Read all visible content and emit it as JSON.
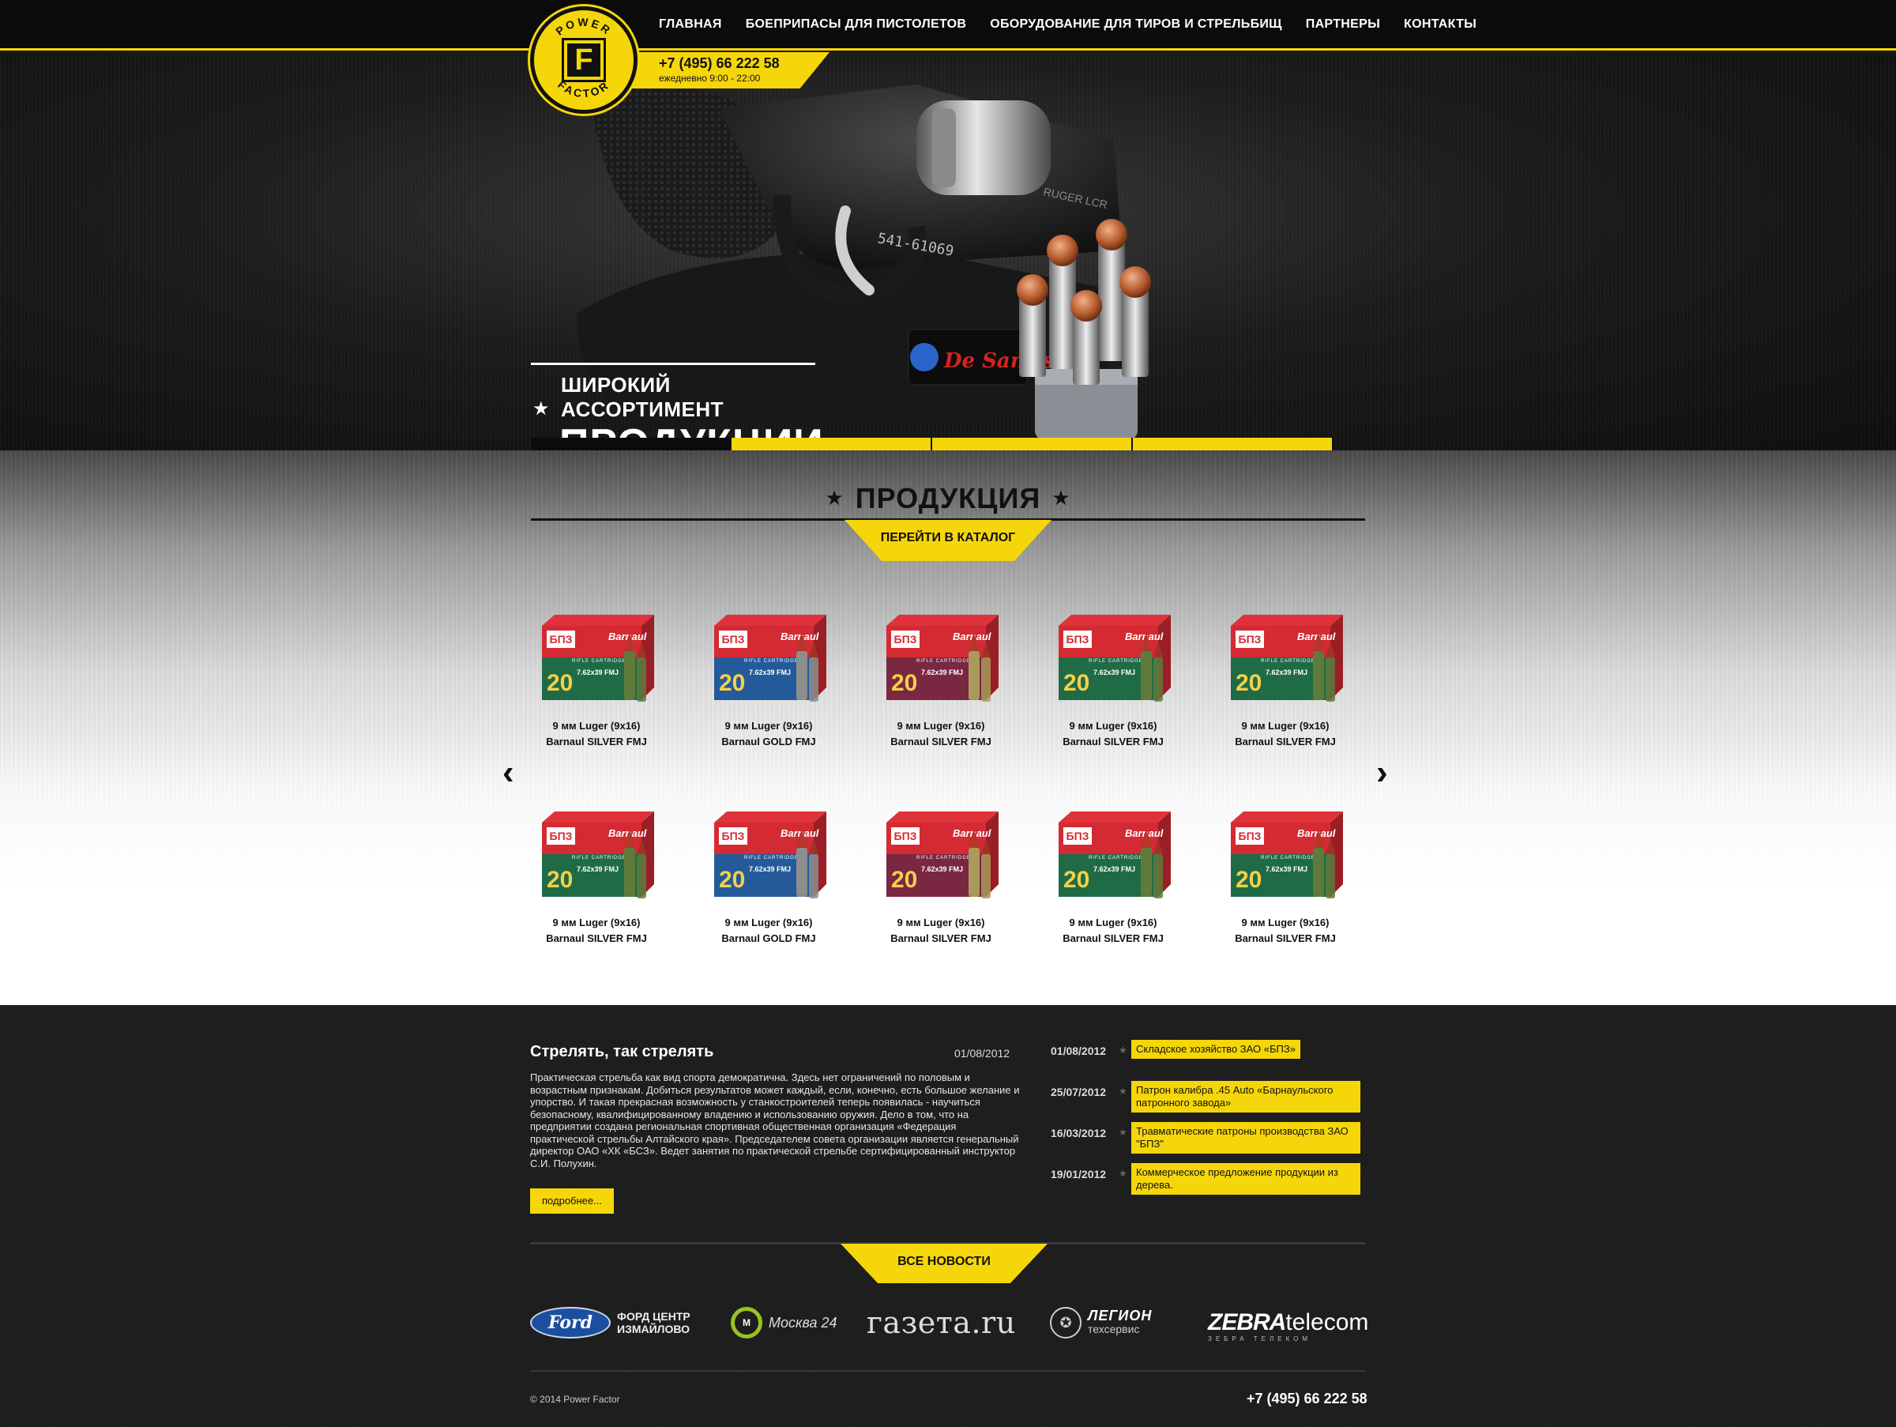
{
  "brand": {
    "logo_top": "POWER",
    "logo_bottom": "FACTOR",
    "logo_letter": "F"
  },
  "nav": [
    {
      "label": "Главная"
    },
    {
      "label": "Боеприпасы для пистолетов"
    },
    {
      "label": "Оборудование для тиров и стрельбищ"
    },
    {
      "label": "Партнеры"
    },
    {
      "label": "Контакты"
    }
  ],
  "contact": {
    "phone": "+7 (495) 66 222 58",
    "hours": "ежедневно  9:00 - 22:00"
  },
  "hero": {
    "slogan_small": "Широкий ассортимент",
    "slogan_big": "продукции",
    "holster_brand": "De Santis",
    "gun_serial": "541-61069",
    "gun_model": "RUGER LCR",
    "slides_total": 4,
    "slide_active": 1
  },
  "products": {
    "title": "Продукция",
    "catalog_button": "Перейти в каталог",
    "items": [
      {
        "line1": "9 мм Luger (9x16)",
        "line2": "Barnaul SILVER FMJ",
        "band_color": "#1f6b46",
        "round_color": "#5f7a3b"
      },
      {
        "line1": "9 мм Luger (9x16)",
        "line2": "Barnaul GOLD FMJ",
        "band_color": "#245a9a",
        "round_color": "#8d8d8d"
      },
      {
        "line1": "9 мм Luger (9x16)",
        "line2": "Barnaul SILVER FMJ",
        "band_color": "#7a2742",
        "round_color": "#a89a5a"
      },
      {
        "line1": "9 мм Luger (9x16)",
        "line2": "Barnaul SILVER FMJ",
        "band_color": "#1f6b46",
        "round_color": "#5f7a3b"
      },
      {
        "line1": "9 мм Luger (9x16)",
        "line2": "Barnaul SILVER FMJ",
        "band_color": "#1f6b46",
        "round_color": "#5f7a3b"
      },
      {
        "line1": "9 мм Luger (9x16)",
        "line2": "Barnaul SILVER FMJ",
        "band_color": "#1f6b46",
        "round_color": "#5f7a3b"
      },
      {
        "line1": "9 мм Luger (9x16)",
        "line2": "Barnaul GOLD FMJ",
        "band_color": "#245a9a",
        "round_color": "#8d8d8d"
      },
      {
        "line1": "9 мм Luger (9x16)",
        "line2": "Barnaul SILVER FMJ",
        "band_color": "#7a2742",
        "round_color": "#a89a5a"
      },
      {
        "line1": "9 мм Luger (9x16)",
        "line2": "Barnaul SILVER FMJ",
        "band_color": "#1f6b46",
        "round_color": "#5f7a3b"
      },
      {
        "line1": "9 мм Luger (9x16)",
        "line2": "Barnaul SILVER FMJ",
        "band_color": "#1f6b46",
        "round_color": "#5f7a3b"
      }
    ],
    "box_count": "20",
    "box_brand": "Barnaul",
    "box_caliber": "7.62x39 FMJ",
    "box_type": "RIFLE CARTRIDGES",
    "box_logo": "БПЗ"
  },
  "news": {
    "featured": {
      "title": "Стрелять, так стрелять",
      "date": "01/08/2012",
      "body": "Практическая стрельба как вид спорта демократична. Здесь нет ограничений по половым и возрастным признакам. Добиться результатов может каждый, если, конечно, есть большое желание и упорство. И такая прекрасная возможность у станкостроителей теперь появилась - научиться безопасному, квалифицированному владению и использованию оружия. Дело в том, что на предприятии создана региональная спортивная общественная организация «Федерация практической стрельбы Алтайского края». Председателем совета организации является генеральный директор ОАО «ХК «БСЗ». Ведет занятия по практической стрельбе сертифицированный инструктор С.И. Полухин.",
      "more": "подробнее..."
    },
    "list": [
      {
        "date": "01/08/2012",
        "title": "Складское хозяйство ЗАО «БПЗ»"
      },
      {
        "date": "25/07/2012",
        "title": "Патрон калибра .45 Auto «Барнаульского патронного завода»"
      },
      {
        "date": "16/03/2012",
        "title": "Травматические патроны производства ЗАО \"БПЗ\""
      },
      {
        "date": "19/01/2012",
        "title": "Коммерческое предложение продукции из дерева."
      }
    ],
    "all_news": "Все новости"
  },
  "partners": {
    "ford_logo": "Ford",
    "ford_text_1": "ФОРД ЦЕНТР",
    "ford_text_2": "ИЗМАЙЛОВО",
    "m24_text": "Москва 24",
    "gazeta": "газета.ru",
    "legion_1": "ЛЕГИОН",
    "legion_2": "техсервис",
    "zebra_1": "ZEBRA",
    "zebra_2": "telecom",
    "zebra_sub": "ЗЕБРА ТЕЛЕКОМ"
  },
  "footer": {
    "copyright": "© 2014 Power Factor",
    "phone": "+7 (495) 66 222 58"
  },
  "colors": {
    "accent": "#f5d60a",
    "dark": "#111111"
  },
  "icons": {
    "prev": "chevron-left-icon",
    "next": "chevron-right-icon",
    "star": "star-icon"
  }
}
